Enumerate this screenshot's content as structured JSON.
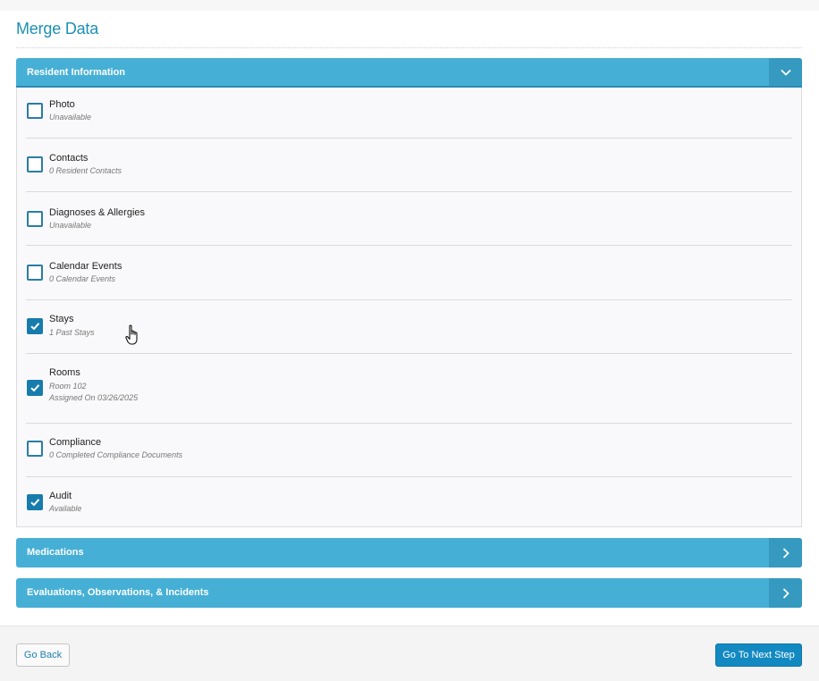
{
  "page": {
    "title": "Merge Data"
  },
  "sections": [
    {
      "label": "Resident Information",
      "expanded": true,
      "toggle_icon": "chevron-down-icon",
      "items": [
        {
          "label": "Photo",
          "sub": [
            "Unavailable"
          ],
          "checked": false
        },
        {
          "label": "Contacts",
          "sub": [
            "0 Resident Contacts"
          ],
          "checked": false
        },
        {
          "label": "Diagnoses & Allergies",
          "sub": [
            "Unavailable"
          ],
          "checked": false
        },
        {
          "label": "Calendar Events",
          "sub": [
            "0 Calendar Events"
          ],
          "checked": false
        },
        {
          "label": "Stays",
          "sub": [
            "1 Past Stays"
          ],
          "checked": true
        },
        {
          "label": "Rooms",
          "sub": [
            "Room 102",
            "Assigned On 03/26/2025"
          ],
          "checked": true
        },
        {
          "label": "Compliance",
          "sub": [
            "0 Completed Compliance Documents"
          ],
          "checked": false
        },
        {
          "label": "Audit",
          "sub": [
            "Available"
          ],
          "checked": true
        }
      ]
    },
    {
      "label": "Medications",
      "expanded": false,
      "toggle_icon": "chevron-right-icon"
    },
    {
      "label": "Evaluations, Observations, & Incidents",
      "expanded": false,
      "toggle_icon": "chevron-right-icon"
    }
  ],
  "footer": {
    "back_label": "Go Back",
    "next_label": "Go To Next Step"
  },
  "colors": {
    "accent": "#46afd6",
    "accent_dark": "#3599c0",
    "primary_button": "#1389c2",
    "checkbox": "#177cab",
    "title": "#1e90b4"
  }
}
